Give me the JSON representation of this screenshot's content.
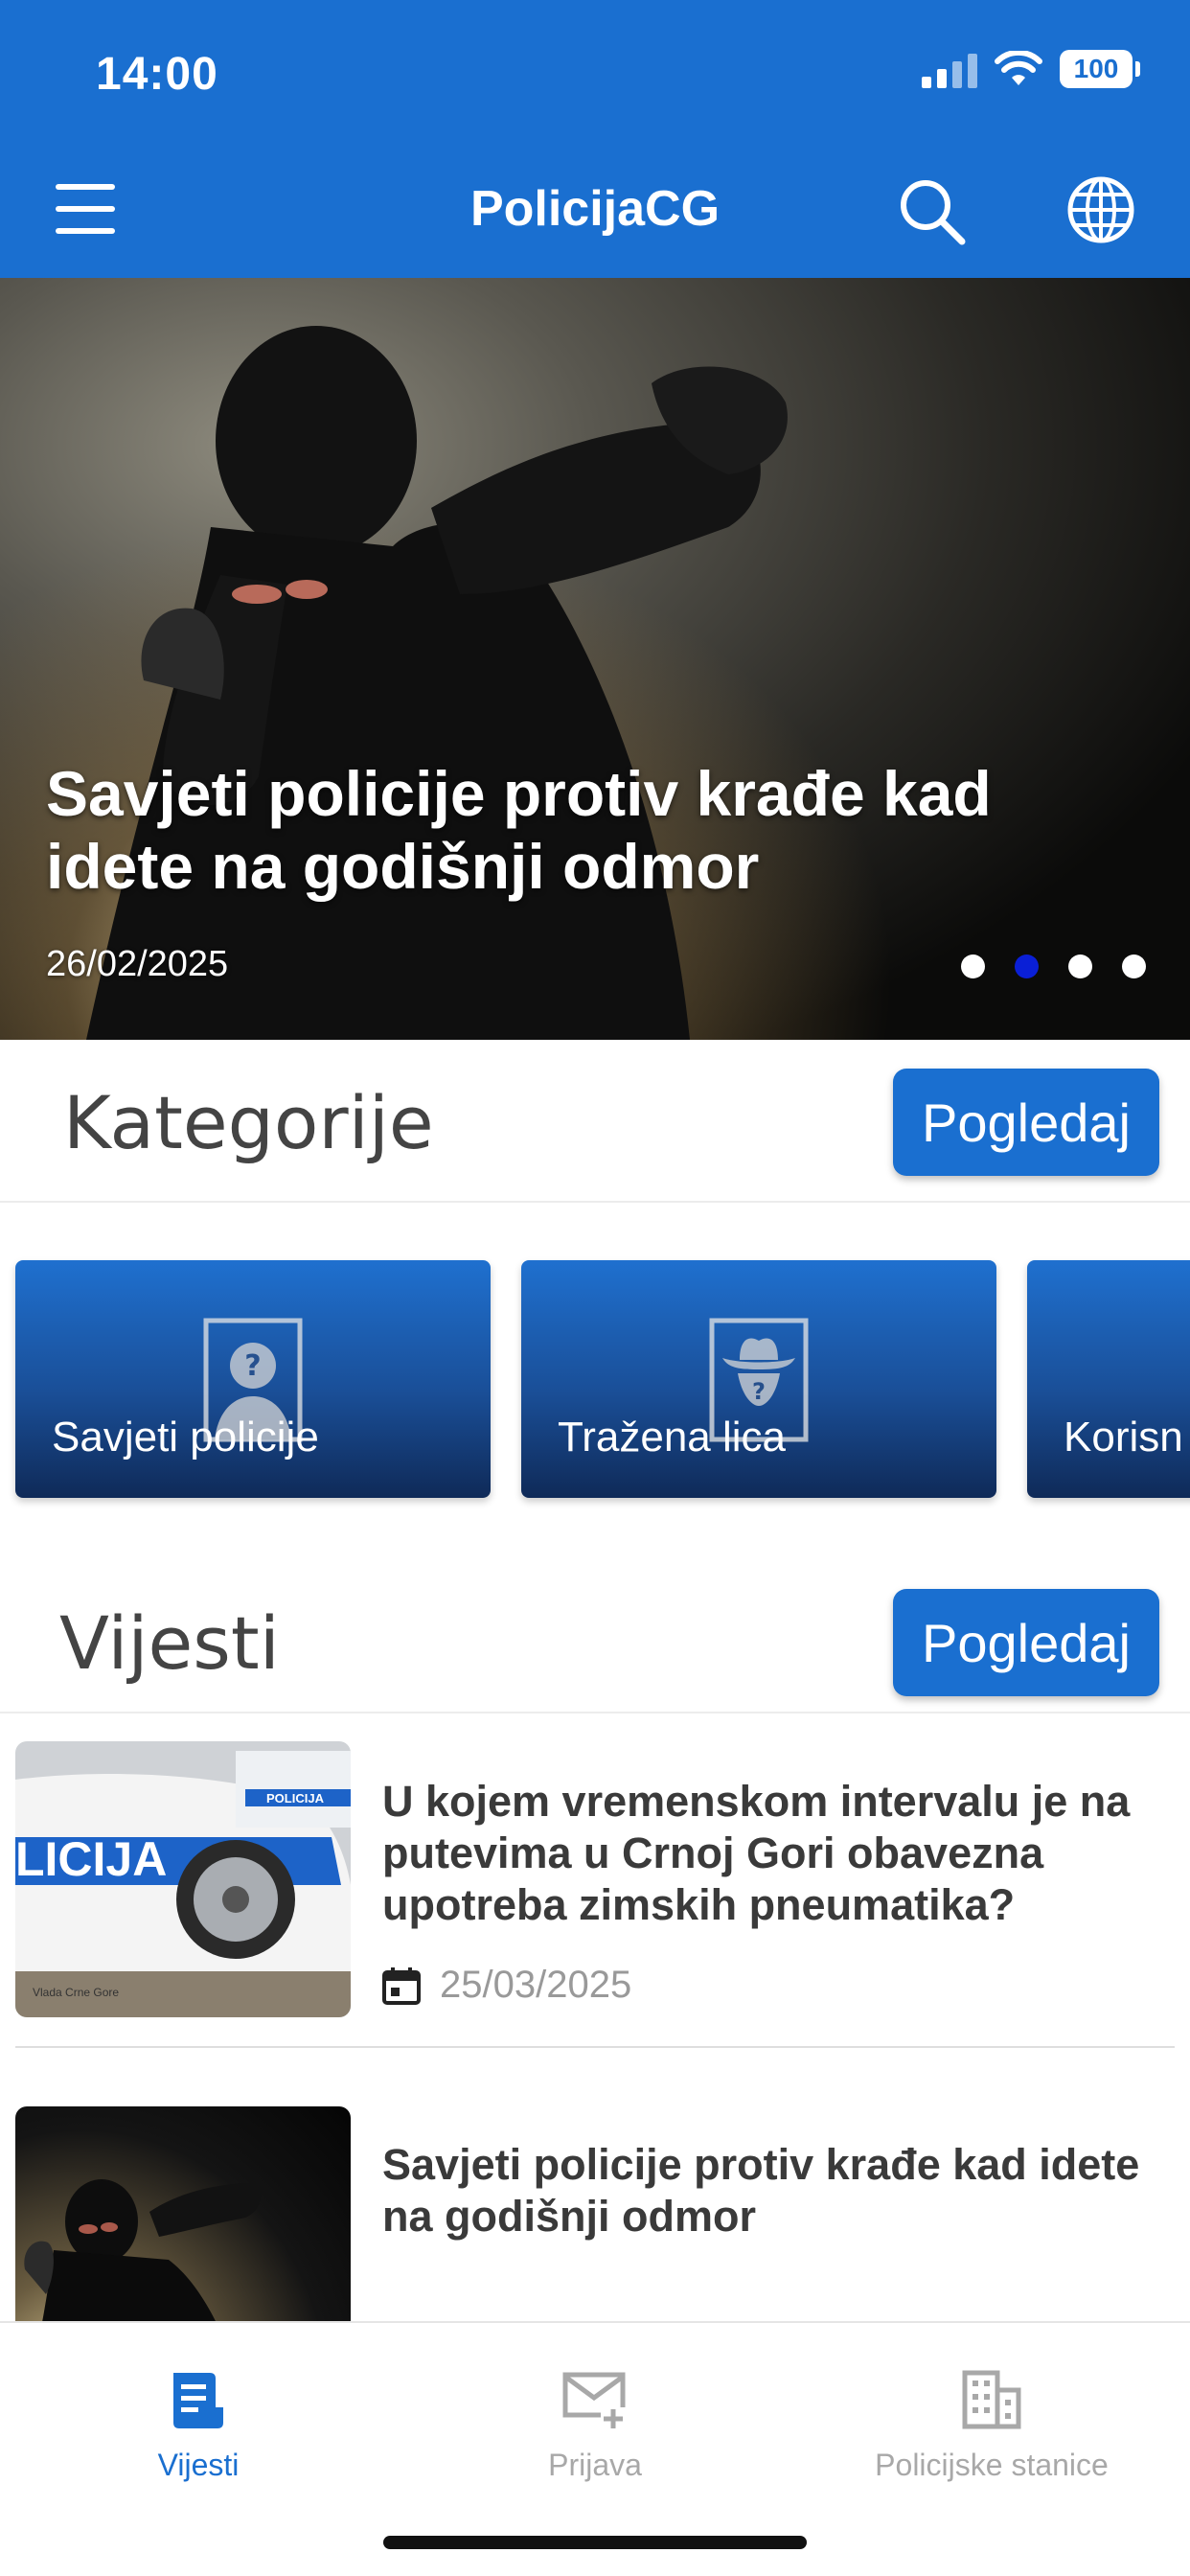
{
  "status_bar": {
    "time": "14:00",
    "battery": "100"
  },
  "header": {
    "title": "PolicijaCG"
  },
  "icons": {
    "menu": "menu-icon",
    "search": "search-icon",
    "language": "globe-icon",
    "calendar": "calendar-icon",
    "news_tab": "document-icon",
    "report_tab": "mail-plus-icon",
    "stations_tab": "building-icon"
  },
  "colors": {
    "primary": "#1a6fd0",
    "active_dot": "#0a1fd6"
  },
  "hero": {
    "title": "Savjeti policije protiv krađe kad idete na godišnji odmor",
    "date": "26/02/2025",
    "slides": 4,
    "active_slide": 2
  },
  "categories": {
    "title": "Kategorije",
    "button": "Pogledaj",
    "items": [
      {
        "label": "Savjeti policije",
        "icon": "person-question-icon"
      },
      {
        "label": "Tražena lica",
        "icon": "wanted-person-icon"
      },
      {
        "label": "Korisn"
      }
    ]
  },
  "news": {
    "title": "Vijesti",
    "button": "Pogledaj",
    "items": [
      {
        "title": "U kojem vremenskom intervalu je na putevima u Crnoj Gori obavezna upotreba zimskih pneumatika?",
        "date": "25/03/2025",
        "thumb_text": "LICIJA",
        "thumb_small": "POLICIJA",
        "thumb_caption": "Vlada Crne Gore"
      },
      {
        "title": "Savjeti policije protiv krađe kad idete na godišnji odmor"
      }
    ]
  },
  "tabs": [
    {
      "label": "Vijesti",
      "active": true
    },
    {
      "label": "Prijava",
      "active": false
    },
    {
      "label": "Policijske stanice",
      "active": false
    }
  ]
}
